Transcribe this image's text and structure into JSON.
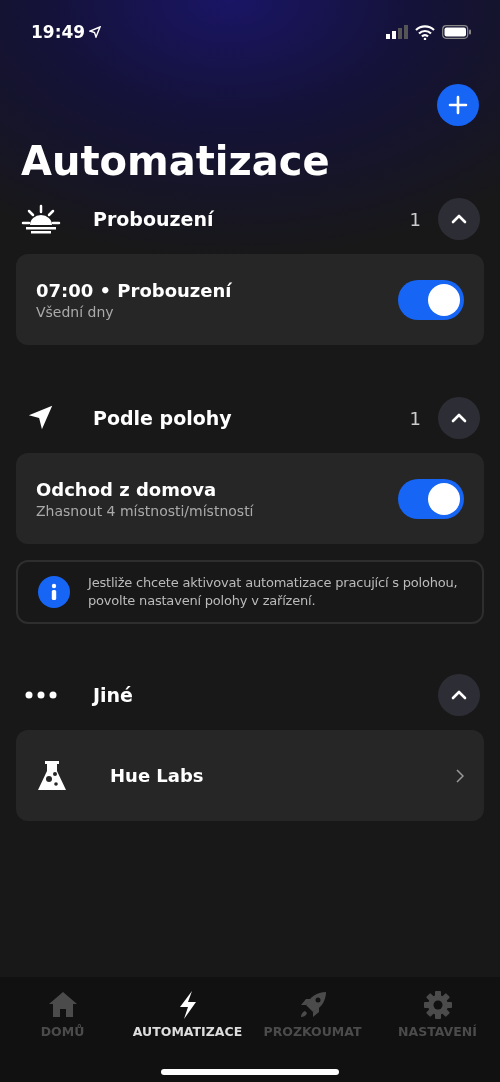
{
  "status_bar": {
    "time": "19:49"
  },
  "title": "Automatizace",
  "sections": [
    {
      "kind": "sunrise",
      "title": "Probouzení",
      "count": "1",
      "expanded": true,
      "items": [
        {
          "kind": "toggle",
          "title": "07:00 • Probouzení",
          "subtitle": "Všední dny",
          "on": true
        }
      ]
    },
    {
      "kind": "location",
      "title": "Podle polohy",
      "count": "1",
      "expanded": true,
      "items": [
        {
          "kind": "toggle",
          "title": "Odchod z domova",
          "subtitle": "Zhasnout 4 místnosti/místností",
          "on": true
        }
      ],
      "note": "Jestliže chcete aktivovat automatizace pracující s polohou, povolte nastavení polohy v zařízení."
    },
    {
      "kind": "more",
      "title": "Jiné",
      "expanded": true,
      "items": [
        {
          "kind": "labs",
          "title": "Hue Labs"
        }
      ]
    }
  ],
  "tabs": [
    {
      "kind": "home",
      "label": "DOMŮ",
      "selected": false
    },
    {
      "kind": "bolt",
      "label": "AUTOMATIZACE",
      "selected": true
    },
    {
      "kind": "rocket",
      "label": "PROZKOUMAT",
      "selected": false
    },
    {
      "kind": "gear",
      "label": "NASTAVENÍ",
      "selected": false
    }
  ]
}
